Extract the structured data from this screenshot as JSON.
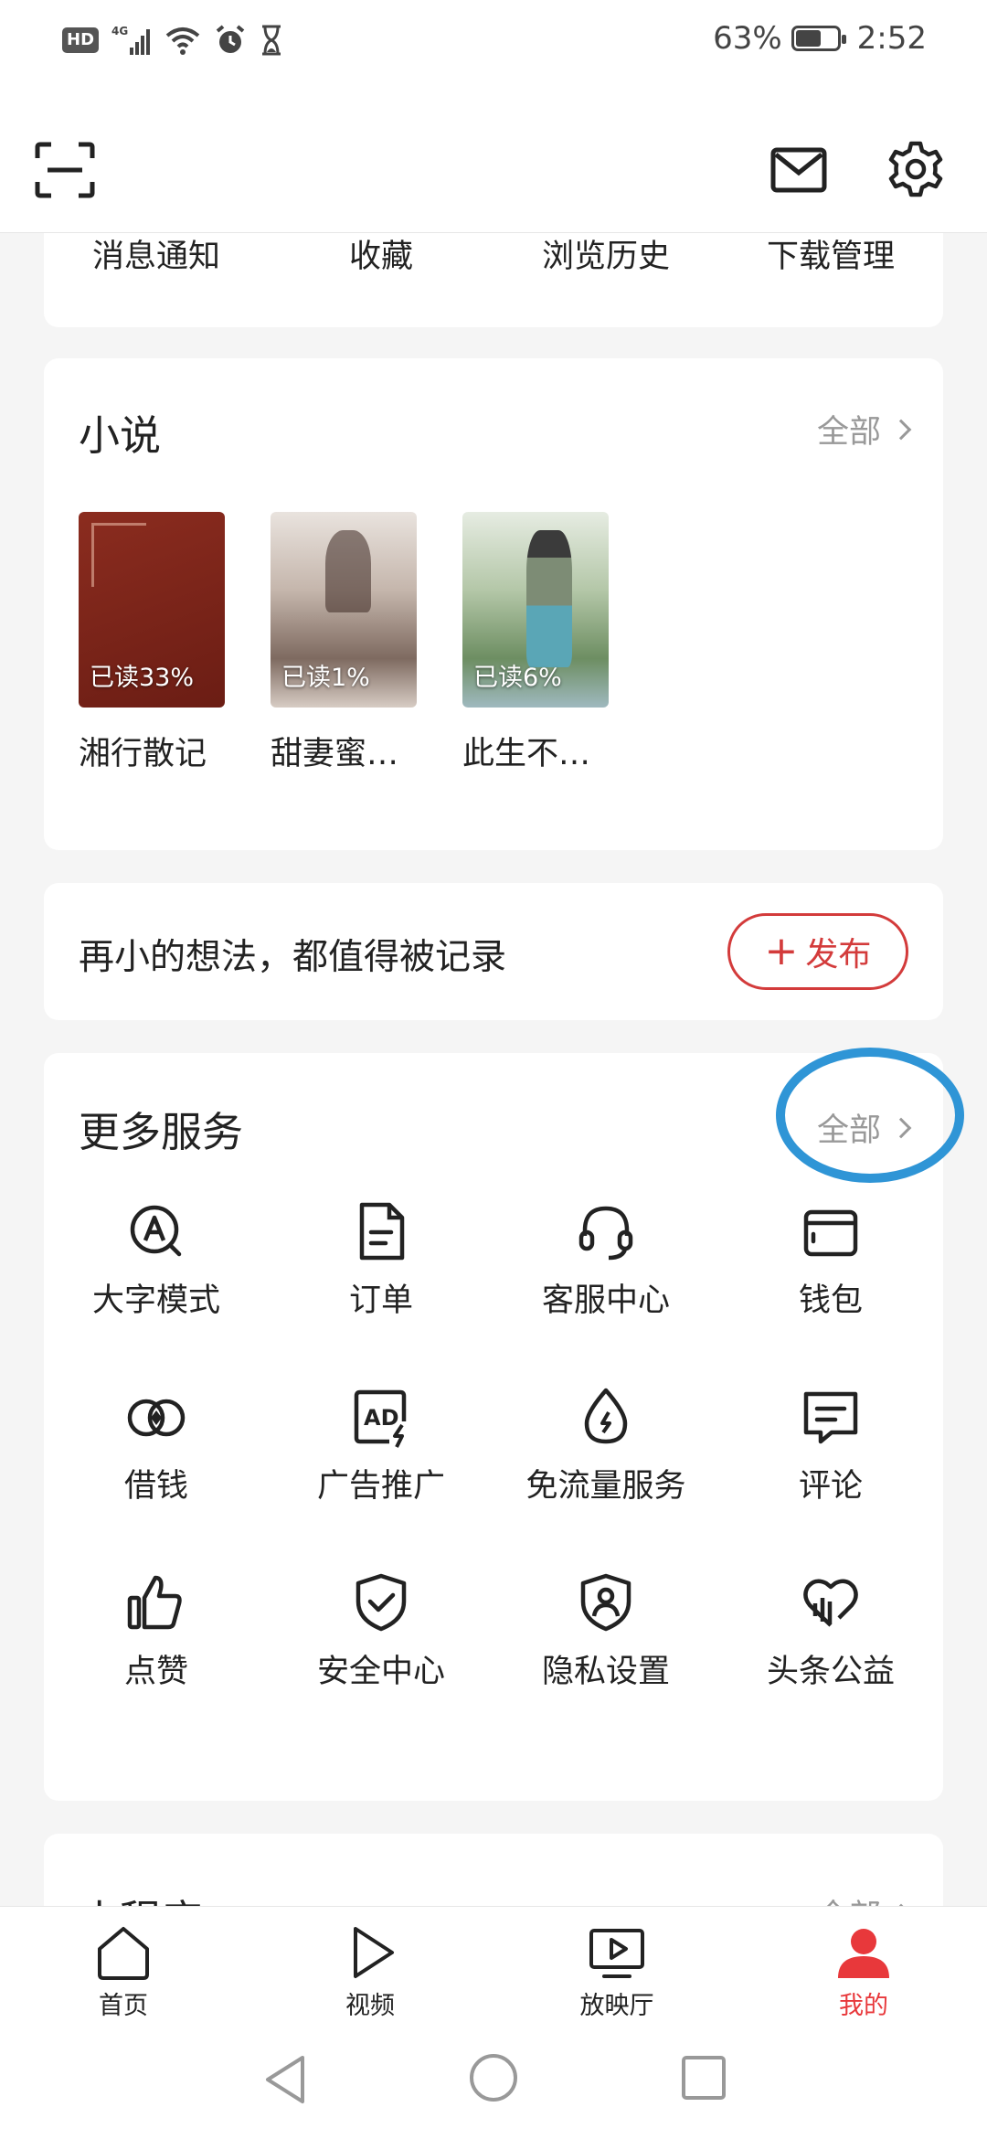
{
  "status_bar": {
    "hd": "HD",
    "network": "4G",
    "battery": "63%",
    "battery_level": 0.63,
    "time": "2:52"
  },
  "top_bar": {
    "icons": [
      "scan-icon",
      "mail-icon",
      "gear-icon"
    ]
  },
  "quick_links": [
    {
      "label": "消息通知"
    },
    {
      "label": "收藏"
    },
    {
      "label": "浏览历史"
    },
    {
      "label": "下载管理"
    }
  ],
  "novel": {
    "title": "小说",
    "more": "全部",
    "books": [
      {
        "title": "湘行散记",
        "progress": "已读33%"
      },
      {
        "title": "甜妻蜜…",
        "progress": "已读1%"
      },
      {
        "title": "此生不…",
        "progress": "已读6%"
      }
    ]
  },
  "post": {
    "text": "再小的想法，都值得被记录",
    "button": "发布"
  },
  "services": {
    "title": "更多服务",
    "more": "全部",
    "highlight_color": "#2f95d6",
    "items": [
      {
        "label": "大字模式",
        "icon": "font-size-icon"
      },
      {
        "label": "订单",
        "icon": "order-icon"
      },
      {
        "label": "客服中心",
        "icon": "headset-icon"
      },
      {
        "label": "钱包",
        "icon": "wallet-icon"
      },
      {
        "label": "借钱",
        "icon": "loan-icon"
      },
      {
        "label": "广告推广",
        "icon": "ad-icon"
      },
      {
        "label": "免流量服务",
        "icon": "data-free-icon"
      },
      {
        "label": "评论",
        "icon": "comment-icon"
      },
      {
        "label": "点赞",
        "icon": "thumbs-up-icon"
      },
      {
        "label": "安全中心",
        "icon": "shield-check-icon"
      },
      {
        "label": "隐私设置",
        "icon": "privacy-icon"
      },
      {
        "label": "头条公益",
        "icon": "charity-icon"
      }
    ]
  },
  "mini_programs": {
    "title": "小程序",
    "more": "全部"
  },
  "bottom_nav": [
    {
      "label": "首页",
      "icon": "home-icon"
    },
    {
      "label": "视频",
      "icon": "play-icon"
    },
    {
      "label": "放映厅",
      "icon": "tv-icon"
    },
    {
      "label": "我的",
      "icon": "profile-icon",
      "active": true
    }
  ],
  "colors": {
    "accent_red": "#e8383b",
    "button_red": "#d33b3b",
    "muted": "#999999"
  }
}
